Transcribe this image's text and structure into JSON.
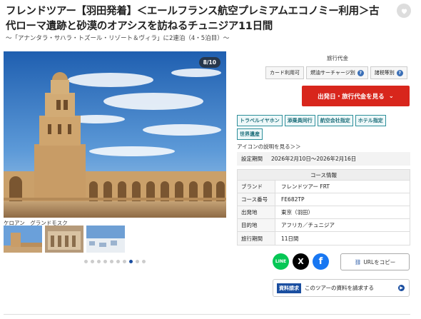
{
  "header": {
    "title": "フレンドツアー【羽田発着】＜エールフランス航空プレミアムエコノミー利用＞古代ローマ遺跡と砂漠のオアシスを訪ねるチュニジア11日間",
    "subtitle": "～「アナンタラ・サハラ・トズール・リゾート＆ヴィラ」に2連泊（4・5泊目）～"
  },
  "gallery": {
    "counter": "8/10",
    "caption": "ケロアン　グランドモスク",
    "dots_total": 10,
    "dots_active": 7
  },
  "fees": {
    "title": "旅行代金",
    "buttons": [
      {
        "label": "カード利用可",
        "help": false
      },
      {
        "label": "燃油サーチャージ別",
        "help": true
      },
      {
        "label": "諸税等別",
        "help": true
      }
    ],
    "cta_label": "出発日・旅行代金を見る",
    "colors": {
      "cta": "#d8261c",
      "accent": "#1a4ea0",
      "tag": "#2e8f9b"
    }
  },
  "tags": [
    "トラベルイヤホン",
    "添乗員同行",
    "航空会社指定",
    "ホテル指定",
    "世界遺産"
  ],
  "icon_link": "アイコンの説明を見る＞＞",
  "period": {
    "label": "設定期間",
    "value": "2026年2月10日～2026年2月16日"
  },
  "course": {
    "header": "コース情報",
    "rows": [
      {
        "key": "ブランド",
        "value": "フレンドツアー FRT"
      },
      {
        "key": "コース番号",
        "value": "FE682TP"
      },
      {
        "key": "出発地",
        "value": "東京（羽田）"
      },
      {
        "key": "目的地",
        "value": "アフリカ／チュニジア"
      },
      {
        "key": "旅行期間",
        "value": "11日間"
      }
    ]
  },
  "social": {
    "line_label": "LINE",
    "x_label": "X",
    "fb_label": "f",
    "url_copy": "URLをコピー"
  },
  "request": {
    "badge": "資料請求",
    "label": "このツアーの資料を請求する"
  }
}
